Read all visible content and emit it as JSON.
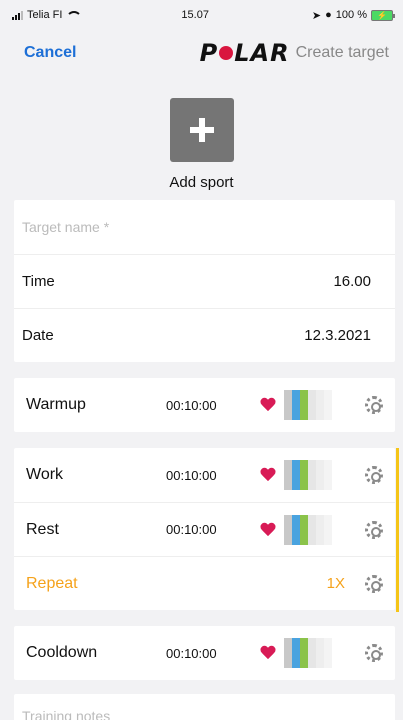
{
  "status": {
    "carrier": "Telia FI",
    "time": "15.07",
    "battery": "100 %"
  },
  "nav": {
    "cancel": "Cancel",
    "brand": "POLAR",
    "title": "Create target"
  },
  "add_sport": {
    "label": "Add sport",
    "icon": "plus-icon"
  },
  "form": {
    "target_name_placeholder": "Target name *",
    "time_label": "Time",
    "time_value": "16.00",
    "date_label": "Date",
    "date_value": "12.3.2021"
  },
  "phases": {
    "warmup": {
      "name": "Warmup",
      "duration": "00:10:00"
    },
    "work": {
      "name": "Work",
      "duration": "00:10:00"
    },
    "rest": {
      "name": "Rest",
      "duration": "00:10:00"
    },
    "repeat": {
      "label": "Repeat",
      "count": "1X"
    },
    "cooldown": {
      "name": "Cooldown",
      "duration": "00:10:00"
    }
  },
  "notes_placeholder": "Training notes",
  "colors": {
    "accent_blue": "#1d6fd6",
    "heart": "#d81b56",
    "repeat": "#f5a21b",
    "repeat_bar": "#f5c518"
  }
}
